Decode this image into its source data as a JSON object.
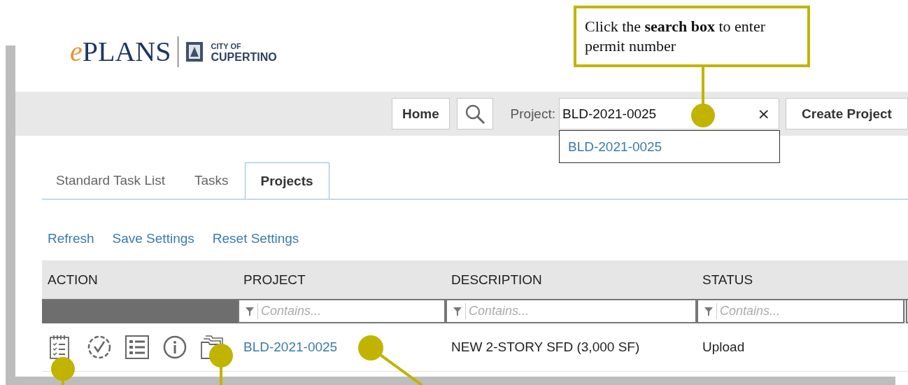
{
  "logo": {
    "brand_prefix": "e",
    "brand": "PLANS",
    "agency_line1": "CITY OF",
    "agency_line2": "CUPERTINO"
  },
  "toolbar": {
    "home_button": "Home",
    "project_label": "Project:",
    "project_field": {
      "value": "BLD-2021-0025"
    },
    "clear_button": "×",
    "create_button": "Create Project"
  },
  "suggestions": [
    "BLD-2021-0025"
  ],
  "tabs": [
    {
      "label": "Standard Task List",
      "selected": false
    },
    {
      "label": "Tasks",
      "selected": false
    },
    {
      "label": "Projects",
      "selected": true
    }
  ],
  "actions": [
    "Refresh",
    "Save Settings",
    "Reset Settings"
  ],
  "table": {
    "columns": [
      {
        "label": "ACTION"
      },
      {
        "label": "PROJECT",
        "filter_placeholder": "Contains..."
      },
      {
        "label": "DESCRIPTION",
        "filter_placeholder": "Contains..."
      },
      {
        "label": "STATUS",
        "filter_placeholder": "Contains..."
      }
    ],
    "rows": [
      {
        "project": "BLD-2021-0025",
        "description": "NEW 2-STORY SFD (3,000 SF)",
        "status": "Upload"
      }
    ]
  },
  "callout": {
    "text": "Click the **search box** to enter permit number"
  }
}
